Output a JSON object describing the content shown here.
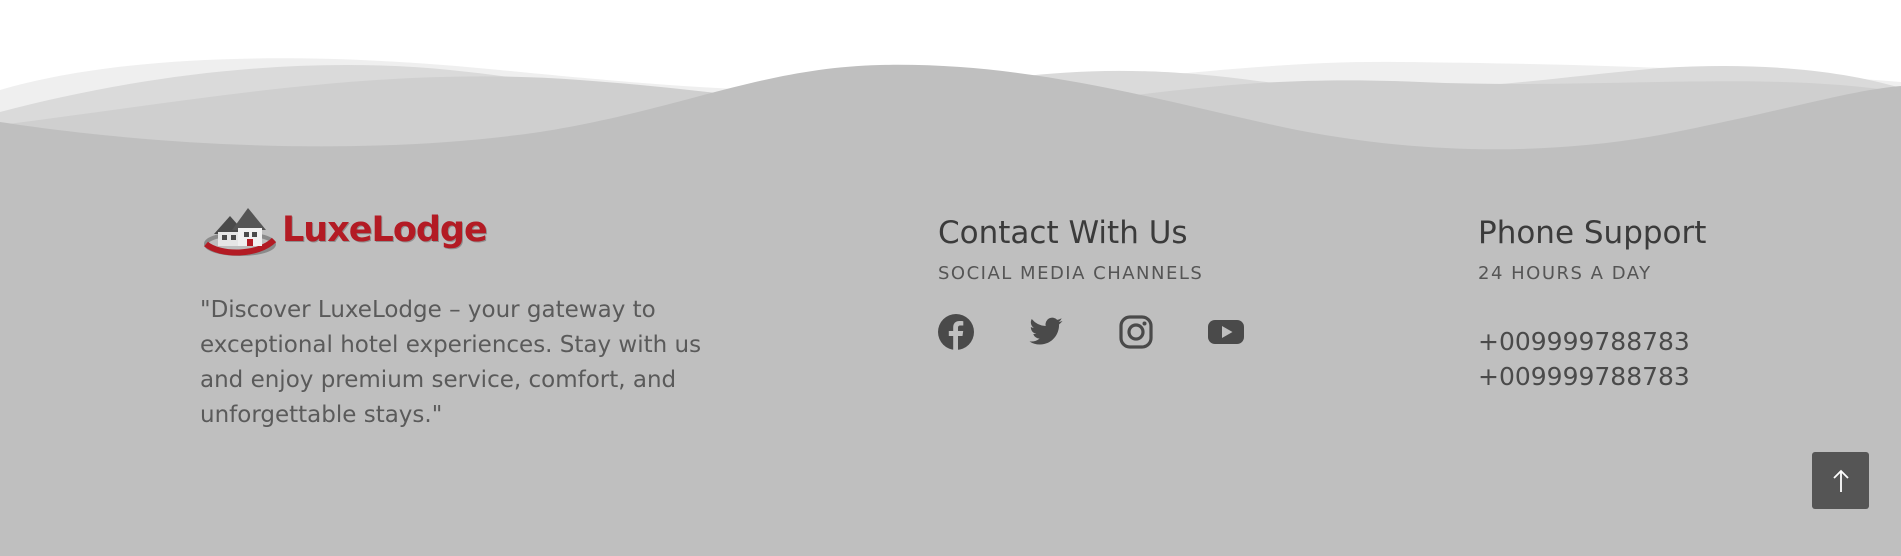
{
  "brand": {
    "logo_text": "LuxeLodge",
    "tagline": "\"Discover LuxeLodge – your gateway to exceptional hotel experiences. Stay with us and enjoy premium service, comfort, and unforgettable stays.\""
  },
  "contact": {
    "title": "Contact With Us",
    "subtitle": "SOCIAL MEDIA CHANNELS",
    "socials": [
      {
        "icon": "facebook-icon"
      },
      {
        "icon": "twitter-icon"
      },
      {
        "icon": "instagram-icon"
      },
      {
        "icon": "youtube-icon"
      }
    ]
  },
  "phone": {
    "title": "Phone Support",
    "subtitle": "24 HOURS A DAY",
    "numbers": [
      "+009999788783",
      "+009999788783"
    ]
  },
  "back_to_top": {
    "icon": "arrow-up-icon"
  },
  "colors": {
    "footer_bg": "#bfbfbf",
    "brand_red": "#b31b24",
    "heading": "#3b3b3b",
    "button_bg": "#555555"
  }
}
